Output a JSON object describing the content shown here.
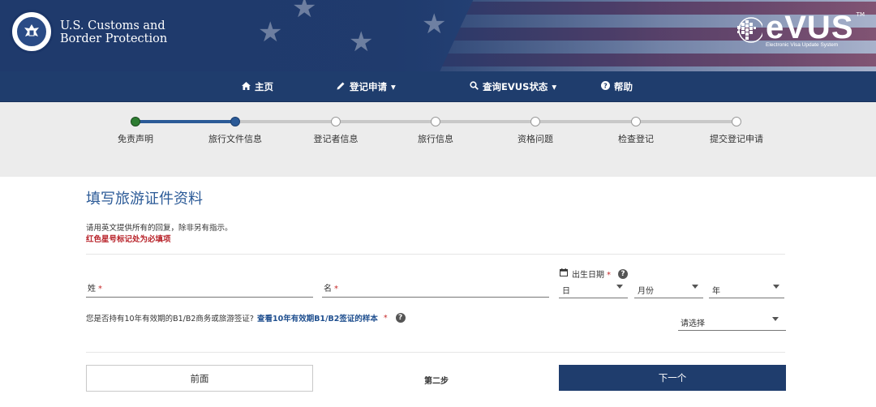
{
  "header": {
    "agency_line1": "U.S. Customs and",
    "agency_line2": "Border Protection",
    "logo_text": "eVUS",
    "logo_tm": "TM",
    "logo_sub": "Electronic Visa Update System"
  },
  "nav": {
    "items": [
      {
        "label": "主页",
        "icon": "home-icon"
      },
      {
        "label": "登记申请",
        "icon": "pencil-icon",
        "dropdown": true
      },
      {
        "label": "查询EVUS状态",
        "icon": "search-icon",
        "dropdown": true
      },
      {
        "label": "帮助",
        "icon": "help-icon"
      }
    ],
    "dropdown_caret": "▾"
  },
  "progress": {
    "steps": [
      {
        "label": "免责声明",
        "state": "done"
      },
      {
        "label": "旅行文件信息",
        "state": "current"
      },
      {
        "label": "登记者信息",
        "state": "pending"
      },
      {
        "label": "旅行信息",
        "state": "pending"
      },
      {
        "label": "资格问题",
        "state": "pending"
      },
      {
        "label": "检查登记",
        "state": "pending"
      },
      {
        "label": "提交登记申请",
        "state": "pending"
      }
    ]
  },
  "form": {
    "title": "填写旅游证件资料",
    "hint": "请用英文提供所有的回复，除非另有指示。",
    "required_note": "红色星号标记处为必填项",
    "required_mark": "*",
    "surname_label": "姓",
    "given_name_label": "名",
    "dob_label": "出生日期",
    "dob_day": "日",
    "dob_month": "月份",
    "dob_year": "年",
    "visa_question": "您是否持有10年有效期的B1/B2商务或旅游签证?",
    "visa_sample_link": "查看10年有效期B1/B2签证的样本",
    "visa_select_value": "请选择"
  },
  "footer": {
    "prev_label": "前面",
    "step_text": "第二步",
    "next_label": "下一个"
  },
  "colors": {
    "brand_navy": "#1f3d6d",
    "title_blue": "#2b5a97",
    "required_red": "#c62828",
    "done_green": "#2e7d32"
  }
}
